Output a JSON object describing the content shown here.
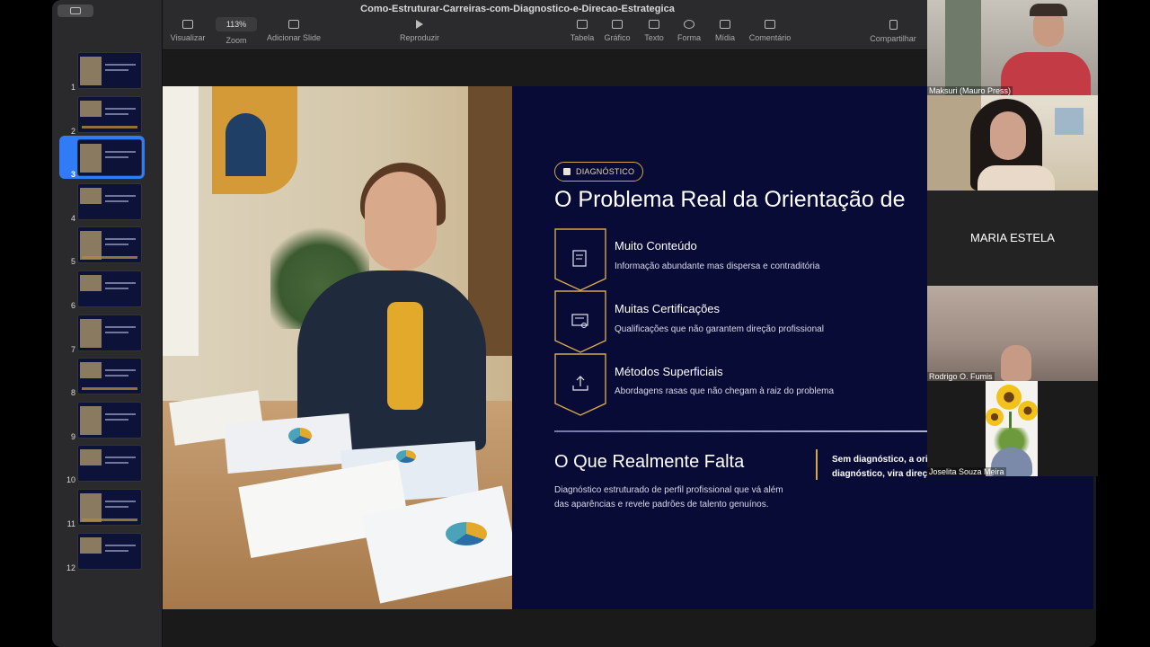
{
  "window": {
    "title": "Como-Estruturar-Carreiras-com-Diagnostico-e-Direcao-Estrategica"
  },
  "toolbar": {
    "view_label": "Visualizar",
    "zoom_value": "113%",
    "zoom_label": "Zoom",
    "add_slide_label": "Adicionar Slide",
    "play_label": "Reproduzir",
    "table_label": "Tabela",
    "chart_label": "Gráfico",
    "text_label": "Texto",
    "shape_label": "Forma",
    "media_label": "Mídia",
    "comment_label": "Comentário",
    "share_label": "Compartilhar"
  },
  "sidebar": {
    "slides": [
      "1",
      "2",
      "3",
      "4",
      "5",
      "6",
      "7",
      "8",
      "9",
      "10",
      "11",
      "12"
    ],
    "selected": "3"
  },
  "slide": {
    "badge": "DIAGNÓSTICO",
    "title": "O Problema Real da Orientação de",
    "features": [
      {
        "icon": "document-icon",
        "title": "Muito Conteúdo",
        "desc": "Informação abundante mas dispersa e contraditória"
      },
      {
        "icon": "certificate-icon",
        "title": "Muitas Certificações",
        "desc": "Qualificações que não garantem direção profissional"
      },
      {
        "icon": "upload-icon",
        "title": "Métodos Superficiais",
        "desc": "Abordagens rasas que não chegam à raiz do problema"
      }
    ],
    "missing_title": "O Que Realmente Falta",
    "missing_text": "Diagnóstico estruturado de perfil profissional que vá além das aparências e revele padrões de talento genuínos.",
    "quote_line1": "Sem diagnóstico, a orie",
    "quote_line2": "diagnóstico, vira direçã"
  },
  "participants": {
    "p1": "Maksuri (Mauro Press)",
    "p3": "MARIA ESTELA",
    "p4": "Rodrigo O. Fumis",
    "p5": "Joselita Souza Meira"
  },
  "colors": {
    "accent": "#d6a84a",
    "slide_bg": "#070b36",
    "selection": "#2f7cf6"
  }
}
